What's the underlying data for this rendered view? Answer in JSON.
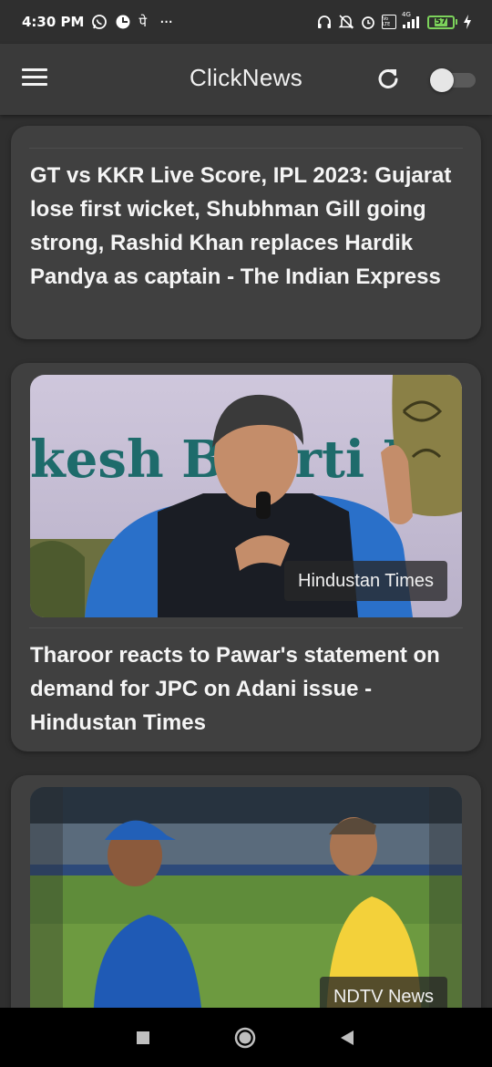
{
  "status_bar": {
    "time": "4:30 PM",
    "left_icons": [
      "whatsapp-icon",
      "data-saver-icon",
      "hindi-keyboard-icon",
      "more-notifications-icon"
    ],
    "hindi_glyph": "पे",
    "more_glyph": "···",
    "right_icons": [
      "headphones-icon",
      "mute-icon",
      "alarm-icon",
      "volte-icon",
      "signal-icon",
      "battery-icon",
      "charging-icon"
    ],
    "network_label": "4G",
    "volte_label": "Vo LTE",
    "battery_level": "57",
    "battery_color": "#7cd35b"
  },
  "app_bar": {
    "title": "ClickNews",
    "menu_icon": "hamburger-menu-icon",
    "refresh_icon": "refresh-icon",
    "dark_mode_toggle": "off"
  },
  "articles": [
    {
      "title": "GT vs KKR Live Score, IPL 2023: Gujarat lose first wicket, Shubhman Gill going strong, Rashid Khan replaces Hardik Pandya as captain - The Indian Express",
      "has_image": false
    },
    {
      "title": "Tharoor reacts to Pawar's statement on demand for JPC on Adani issue - Hindustan Times",
      "source": "Hindustan Times",
      "image_banner_text": "kesh Bharti M",
      "has_image": true
    },
    {
      "title": "",
      "source": "NDTV News",
      "has_image": true
    }
  ],
  "nav_bar": {
    "buttons": [
      "recents-square-icon",
      "home-circle-icon",
      "back-triangle-icon"
    ]
  },
  "colors": {
    "background": "#2f2f2f",
    "app_bar": "#3a3a3a",
    "card": "#404040",
    "text": "#f5f5f5"
  }
}
